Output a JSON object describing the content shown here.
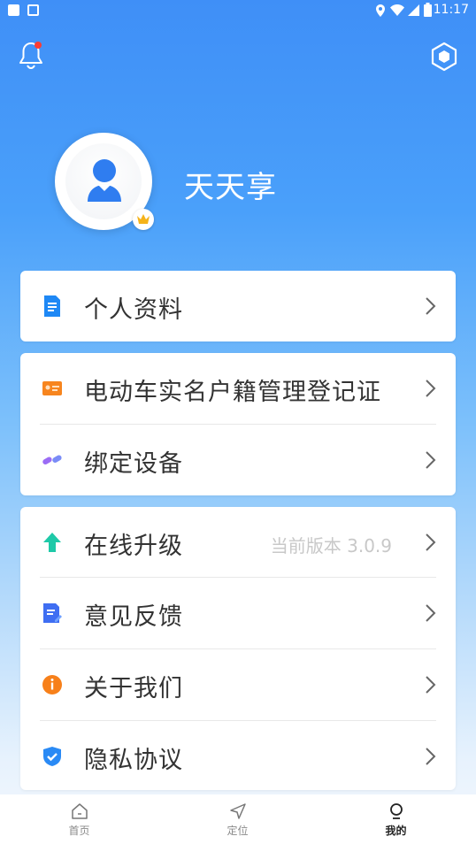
{
  "status_bar": {
    "time": "11:17"
  },
  "header": {
    "bell_icon": "bell-icon",
    "settings_icon": "hexagon-settings-icon",
    "has_notification": true
  },
  "profile": {
    "username": "天天享"
  },
  "menu": {
    "card1": [
      {
        "label": "个人资料",
        "icon": "document-icon"
      }
    ],
    "card2": [
      {
        "label": "电动车实名户籍管理登记证",
        "icon": "id-card-icon"
      },
      {
        "label": "绑定设备",
        "icon": "link-icon"
      }
    ],
    "card3": [
      {
        "label": "在线升级",
        "icon": "upgrade-arrow-icon",
        "extra": "当前版本 3.0.9"
      },
      {
        "label": "意见反馈",
        "icon": "feedback-icon"
      },
      {
        "label": "关于我们",
        "icon": "info-icon"
      },
      {
        "label": "隐私协议",
        "icon": "shield-icon"
      }
    ]
  },
  "tabbar": {
    "tabs": [
      {
        "label": "首页",
        "icon": "home-icon",
        "active": false
      },
      {
        "label": "定位",
        "icon": "navigation-icon",
        "active": false
      },
      {
        "label": "我的",
        "icon": "profile-icon",
        "active": true
      }
    ]
  },
  "colors": {
    "primary": "#3f8ff7",
    "notification_dot": "#ff3b30"
  }
}
